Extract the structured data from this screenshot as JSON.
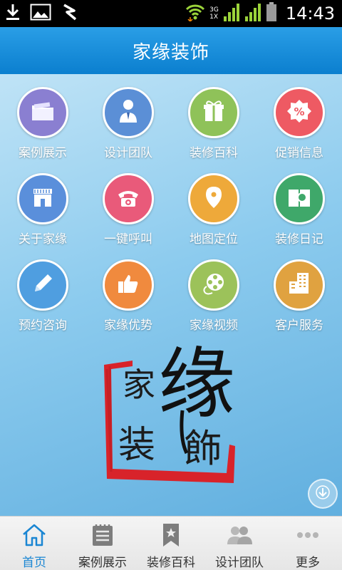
{
  "status_bar": {
    "time": "14:43",
    "network_type_top": "3G",
    "network_type_bottom": "1X"
  },
  "app": {
    "title": "家缘装饰"
  },
  "grid": [
    {
      "label": "案例展示",
      "icon": "folder-icon",
      "color": "#8a7fd1"
    },
    {
      "label": "设计团队",
      "icon": "designer-person-icon",
      "color": "#5b8fd6"
    },
    {
      "label": "装修百科",
      "icon": "gift-box-icon",
      "color": "#8fc259"
    },
    {
      "label": "促销信息",
      "icon": "percent-tag-icon",
      "color": "#ee5a63"
    },
    {
      "label": "关于家缘",
      "icon": "storefront-icon",
      "color": "#5a8fdb"
    },
    {
      "label": "一键呼叫",
      "icon": "telephone-icon",
      "color": "#e95a7a"
    },
    {
      "label": "地图定位",
      "icon": "map-pin-icon",
      "color": "#eea93a"
    },
    {
      "label": "装修日记",
      "icon": "diary-search-icon",
      "color": "#3fa86a"
    },
    {
      "label": "预约咨询",
      "icon": "pencil-icon",
      "color": "#4f9ee0"
    },
    {
      "label": "家缘优势",
      "icon": "thumbs-up-icon",
      "color": "#f08a3e"
    },
    {
      "label": "家缘视频",
      "icon": "film-reel-icon",
      "color": "#9cc25a"
    },
    {
      "label": "客户服务",
      "icon": "office-building-icon",
      "color": "#e0a240"
    }
  ],
  "logo": {
    "chars": [
      "家",
      "缘",
      "装",
      "飾"
    ]
  },
  "tabs": [
    {
      "label": "首页",
      "icon": "home-icon",
      "active": true
    },
    {
      "label": "案例展示",
      "icon": "notepad-icon",
      "active": false
    },
    {
      "label": "装修百科",
      "icon": "bookmark-icon",
      "active": false
    },
    {
      "label": "设计团队",
      "icon": "people-icon",
      "active": false
    },
    {
      "label": "更多",
      "icon": "more-dots-icon",
      "active": false
    }
  ],
  "colors": {
    "title_bar": "#1a8fdc",
    "active_tab": "#1a86d3",
    "seal_red": "#d8232a"
  }
}
